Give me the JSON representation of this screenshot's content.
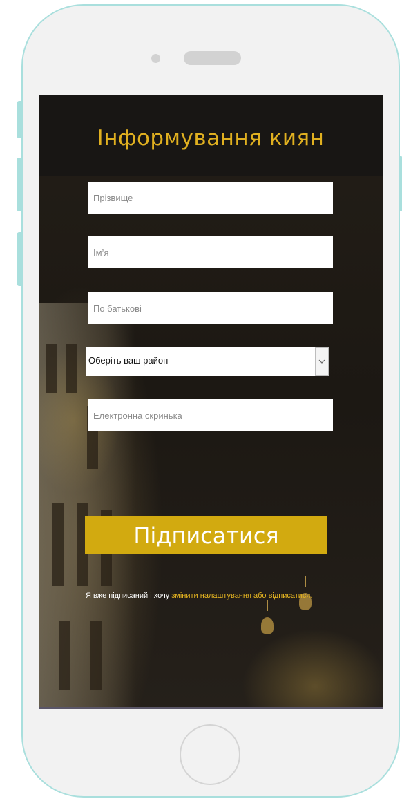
{
  "form": {
    "title": "Інформування киян",
    "fields": {
      "surname_placeholder": "Прізвище",
      "name_placeholder": "Ім’я",
      "patronymic_placeholder": "По батькові",
      "district_selected": "Оберіть ваш район",
      "email_placeholder": "Електронна скринька"
    },
    "submit_label": "Підписатися",
    "note_text": "Я вже підписаний і хочу ",
    "note_link": "змінити налаштування або відписатися."
  },
  "colors": {
    "accent": "#d2aa10",
    "title": "#e0b020",
    "frame": "#a9dfdd"
  },
  "icons": {
    "select_arrow": "chevron-down-icon"
  }
}
